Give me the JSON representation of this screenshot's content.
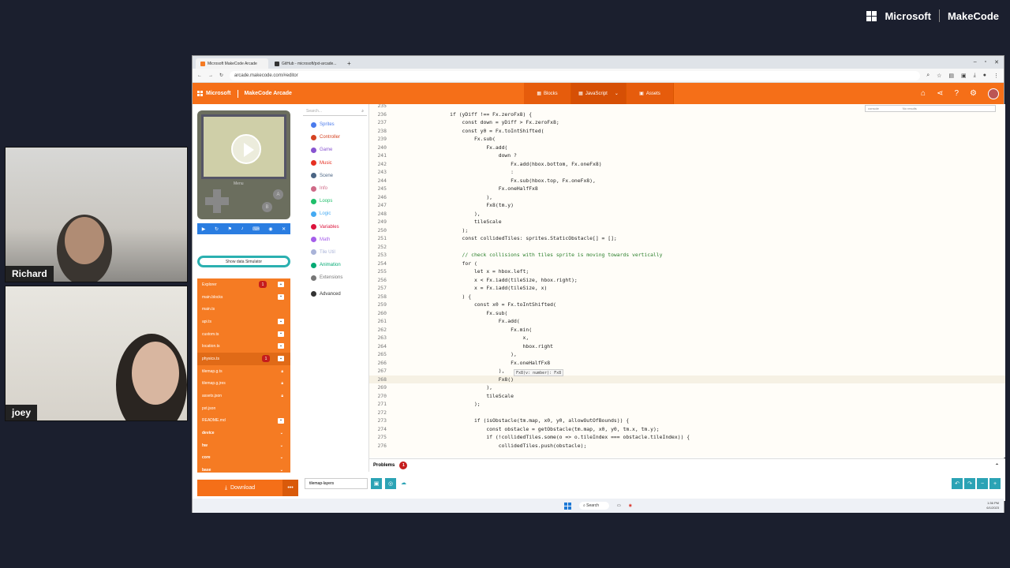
{
  "brand": {
    "company": "Microsoft",
    "product": "MakeCode"
  },
  "participants": [
    {
      "name": "Richard"
    },
    {
      "name": "joey"
    }
  ],
  "browser": {
    "tabs": [
      {
        "label": "Microsoft MakeCode Arcade"
      },
      {
        "label": "GitHub - microsoft/pxt-arcade..."
      }
    ],
    "address": "arcade.makecode.com/#editor"
  },
  "app": {
    "ms_label": "Microsoft",
    "title": "MakeCode Arcade",
    "modes": [
      {
        "label": "Blocks"
      },
      {
        "label": "JavaScript"
      },
      {
        "label": "Assets"
      }
    ]
  },
  "simulator": {
    "menu_label": "Menu",
    "btn_a": "A",
    "btn_b": "B",
    "show_data": "Show data Simulator"
  },
  "toolbox": {
    "search_placeholder": "Search...",
    "categories": [
      {
        "label": "Sprites",
        "color": "#4b7bec"
      },
      {
        "label": "Controller",
        "color": "#d54322"
      },
      {
        "label": "Game",
        "color": "#8854d0"
      },
      {
        "label": "Music",
        "color": "#e63022"
      },
      {
        "label": "Scene",
        "color": "#4b6584"
      },
      {
        "label": "Info",
        "color": "#cf6a87"
      },
      {
        "label": "Loops",
        "color": "#20bf6b"
      },
      {
        "label": "Logic",
        "color": "#45aaf2"
      },
      {
        "label": "Variables",
        "color": "#dc143c"
      },
      {
        "label": "Math",
        "color": "#a55eea"
      },
      {
        "label": "Tile Util",
        "color": "#a9b3d8"
      },
      {
        "label": "Animation",
        "color": "#03aa74"
      },
      {
        "label": "Extensions",
        "color": "#777777"
      },
      {
        "label": "Advanced",
        "color": "#333333"
      }
    ]
  },
  "explorer": {
    "items": [
      {
        "label": "Explorer",
        "badge": "1"
      },
      {
        "label": "main.blocks"
      },
      {
        "label": "main.ts"
      },
      {
        "label": "api.ts"
      },
      {
        "label": "custom.ts"
      },
      {
        "label": "location.ts"
      },
      {
        "label": "physics.ts",
        "badge": "1"
      },
      {
        "label": "tilemap.g.ts"
      },
      {
        "label": "tilemap.g.jres"
      },
      {
        "label": "assets.json"
      },
      {
        "label": "pxt.json"
      },
      {
        "label": "README.md"
      },
      {
        "label": "device"
      },
      {
        "label": "hw"
      },
      {
        "label": "core"
      },
      {
        "label": "base"
      }
    ]
  },
  "code": {
    "lines": [
      {
        "n": "235",
        "t": "                                 "
      },
      {
        "n": "236",
        "t": "            if (yDiff !== Fx.zeroFx8) {"
      },
      {
        "n": "237",
        "t": "                const down = yDiff > Fx.zeroFx8;"
      },
      {
        "n": "238",
        "t": "                const y0 = Fx.toIntShifted("
      },
      {
        "n": "239",
        "t": "                    Fx.sub("
      },
      {
        "n": "240",
        "t": "                        Fx.add("
      },
      {
        "n": "241",
        "t": "                            down ?"
      },
      {
        "n": "242",
        "t": "                                Fx.add(hbox.bottom, Fx.oneFx8)"
      },
      {
        "n": "243",
        "t": "                                :"
      },
      {
        "n": "244",
        "t": "                                Fx.sub(hbox.top, Fx.oneFx8),"
      },
      {
        "n": "245",
        "t": "                            Fx.oneHalfFx8"
      },
      {
        "n": "246",
        "t": "                        ),"
      },
      {
        "n": "247",
        "t": "                        Fx8(tm.y)"
      },
      {
        "n": "248",
        "t": "                    ),"
      },
      {
        "n": "249",
        "t": "                    tileScale"
      },
      {
        "n": "250",
        "t": "                );"
      },
      {
        "n": "251",
        "t": "                const collidedTiles: sprites.StaticObstacle[] = [];"
      },
      {
        "n": "252",
        "t": ""
      },
      {
        "n": "253",
        "t": "                // check collisions with tiles sprite is moving towards vertically"
      },
      {
        "n": "254",
        "t": "                for ("
      },
      {
        "n": "255",
        "t": "                    let x = hbox.left;"
      },
      {
        "n": "256",
        "t": "                    x < Fx.iadd(tileSize, hbox.right);"
      },
      {
        "n": "257",
        "t": "                    x = Fx.iadd(tileSize, x)"
      },
      {
        "n": "258",
        "t": "                ) {"
      },
      {
        "n": "259",
        "t": "                    const x0 = Fx.toIntShifted("
      },
      {
        "n": "260",
        "t": "                        Fx.sub("
      },
      {
        "n": "261",
        "t": "                            Fx.add("
      },
      {
        "n": "262",
        "t": "                                Fx.min("
      },
      {
        "n": "263",
        "t": "                                    x,"
      },
      {
        "n": "264",
        "t": "                                    hbox.right"
      },
      {
        "n": "265",
        "t": "                                ),"
      },
      {
        "n": "266",
        "t": "                                Fx.oneHalfFx8"
      },
      {
        "n": "267",
        "t": "                            ),"
      },
      {
        "n": "268",
        "t": "                            Fx8()"
      },
      {
        "n": "269",
        "t": "                        ),"
      },
      {
        "n": "270",
        "t": "                        tileScale"
      },
      {
        "n": "271",
        "t": "                    );"
      },
      {
        "n": "272",
        "t": ""
      },
      {
        "n": "273",
        "t": "                    if (isObstacle(tm.map, x0, y0, allowOutOfBounds)) {"
      },
      {
        "n": "274",
        "t": "                        const obstacle = getObstacle(tm.map, x0, y0, tm.x, tm.y);"
      },
      {
        "n": "275",
        "t": "                        if (!collidedTiles.some(o => o.tileIndex === obstacle.tileIndex)) {"
      },
      {
        "n": "276",
        "t": "                            collidedTiles.push(obstacle);"
      }
    ],
    "hint": "Fx8(v: number): Fx8",
    "find_placeholder": "console",
    "find_result": "No results"
  },
  "problems": {
    "label": "Problems",
    "count": "1"
  },
  "bottom": {
    "project_name": "tilemap-layers"
  },
  "download": {
    "label": "Download"
  },
  "taskbar": {
    "search": "Search",
    "time": "1:36 PM",
    "date": "6/1/2023"
  }
}
